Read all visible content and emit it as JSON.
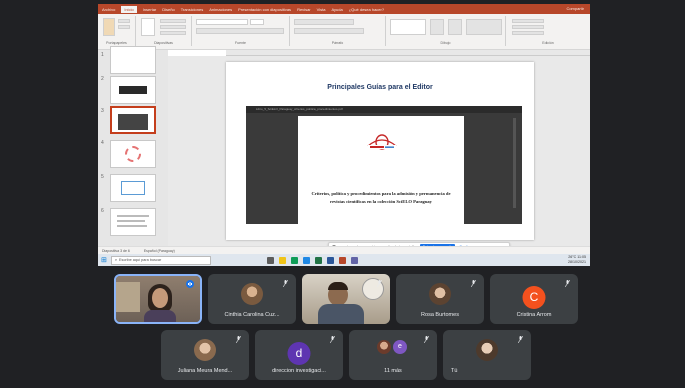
{
  "powerpoint": {
    "tabs": [
      "Archivo",
      "Inicio",
      "Insertar",
      "Diseño",
      "Transiciones",
      "Animaciones",
      "Presentación con diapositivas",
      "Revisar",
      "Vista",
      "Ayuda",
      "¿Qué desea hacer?"
    ],
    "active_tab": "Inicio",
    "user_label": "Compartir",
    "ribbon_groups": [
      "Portapapeles",
      "Diapositivas",
      "Fuente",
      "Párrafo",
      "Dibujo",
      "Edición"
    ],
    "slide_numbers": [
      "1",
      "2",
      "3",
      "4",
      "5",
      "6"
    ],
    "status_left": "Diapositiva 3 de 6",
    "status_lang": "Español (Paraguay)"
  },
  "slide": {
    "title": "Principales Guías para el Editor",
    "embed_bar": "Libro_5_SciELO_Paraguay_criterios_politica_procedimientos.pdf",
    "doc_logo_text": "SciELO Paraguay",
    "doc_text": "Criterios, política y procedimientos para la admisión y permanencia de revistas científicas en la colección SciELO Paraguay"
  },
  "notification": {
    "text": "meet.google.com está compartiendo tu pantalla",
    "primary_button": "Dejar de compartir",
    "secondary_button": "Ocultar"
  },
  "taskbar": {
    "search_placeholder": "Escribe aquí para buscar",
    "tray_temp": "26°C",
    "tray_time": "11:05",
    "tray_date": "28/10/2021"
  },
  "participants": [
    {
      "name": "",
      "type": "video",
      "active": true
    },
    {
      "name": "Cinthia Carolina Cuz...",
      "type": "photo"
    },
    {
      "name": "",
      "type": "video"
    },
    {
      "name": "Rosa Burtomes",
      "type": "photo"
    },
    {
      "name": "Cristina Arrom",
      "type": "letter",
      "letter": "C",
      "color": "#f4511e"
    },
    {
      "name": "Juliana Meura Mend...",
      "type": "photo"
    },
    {
      "name": "direccion investigaci...",
      "type": "letter",
      "letter": "d",
      "color": "#5e35b1"
    },
    {
      "name": "11 más",
      "type": "group"
    },
    {
      "name": "Tú",
      "type": "photo"
    }
  ],
  "colors": {
    "ppt_accent": "#b7472a",
    "meet_bg": "#202124",
    "tile_bg": "#3c4043",
    "active_border": "#8ab4f8"
  }
}
